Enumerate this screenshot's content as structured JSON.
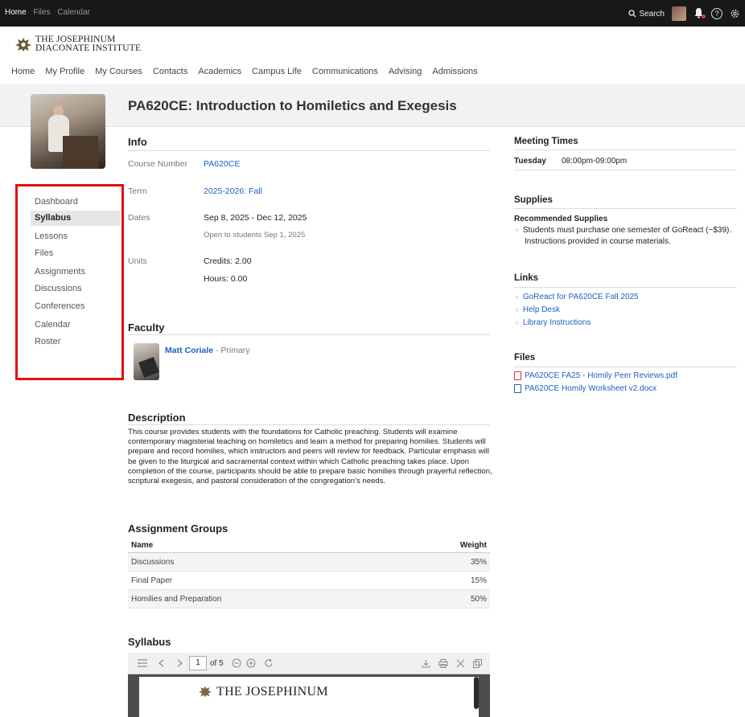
{
  "topbar": {
    "nav": [
      "Home",
      "Files",
      "Calendar"
    ],
    "search_label": "Search",
    "help_glyph": "?"
  },
  "logo": {
    "line1": "THE JOSEPHINUM",
    "line2": "DIACONATE INSTITUTE"
  },
  "main_nav": [
    "Home",
    "My Profile",
    "My Courses",
    "Contacts",
    "Academics",
    "Campus Life",
    "Communications",
    "Advising",
    "Admissions"
  ],
  "course": {
    "title": "PA620CE: Introduction to Homiletics and Exegesis"
  },
  "side_nav": {
    "items": [
      "Dashboard",
      "Syllabus",
      "Lessons",
      "Files",
      "Assignments",
      "Discussions",
      "Conferences",
      "Calendar",
      "Roster"
    ],
    "active": "Syllabus"
  },
  "info": {
    "heading": "Info",
    "course_number_label": "Course Number",
    "course_number": "PA620CE",
    "term_label": "Term",
    "term": "2025-2026: Fall",
    "dates_label": "Dates",
    "dates": "Sep 8, 2025 - Dec 12, 2025",
    "dates_note": "Open to students Sep 1, 2025",
    "units_label": "Units",
    "credits": "Credits: 2.00",
    "hours": "Hours: 0.00"
  },
  "faculty": {
    "heading": "Faculty",
    "name": "Matt Coriale",
    "role": " · Primary"
  },
  "description": {
    "heading": "Description",
    "text": "This course provides students with the foundations for Catholic preaching. Students will examine contemporary magisterial teaching on homiletics and learn a method for preparing homilies. Students will prepare and record homilies, which instructors and peers will review for feedback. Particular emphasis will be given to the liturgical and sacramental context within which Catholic preaching takes place. Upon completion of the course, participants should be able to prepare basic homilies through prayerful reflection, scriptural exegesis, and pastoral consideration of the congregation's needs."
  },
  "assignment_groups": {
    "heading": "Assignment Groups",
    "col_name": "Name",
    "col_weight": "Weight",
    "rows": [
      {
        "name": "Discussions",
        "weight": "35%"
      },
      {
        "name": "Final Paper",
        "weight": "15%"
      },
      {
        "name": "Homilies and Preparation",
        "weight": "50%"
      }
    ]
  },
  "syllabus": {
    "heading": "Syllabus",
    "page": "1",
    "of_pages": "of 5",
    "doc_title": "THE JOSEPHINUM"
  },
  "meeting": {
    "heading": "Meeting Times",
    "day": "Tuesday",
    "time": "08:00pm-09:00pm"
  },
  "supplies": {
    "heading": "Supplies",
    "subheading": "Recommended Supplies",
    "item_line1": "Students must purchase one semester of GoReact (~$39).",
    "item_line2": "Instructions provided in course materials."
  },
  "links": {
    "heading": "Links",
    "items": [
      "GoReact for PA620CE Fall 2025",
      "Help Desk",
      "Library Instructions"
    ]
  },
  "files": {
    "heading": "Files",
    "items": [
      {
        "name": "PA620CE FA25 - Homily Peer Reviews.pdf",
        "type": "pdf-icon"
      },
      {
        "name": "PA620CE Homily Worksheet v2.docx",
        "type": "docx-icon"
      }
    ]
  },
  "colors": {
    "accent_link": "#1f5fbf",
    "highlight_box": "#e01010",
    "topbar": "#181818"
  }
}
